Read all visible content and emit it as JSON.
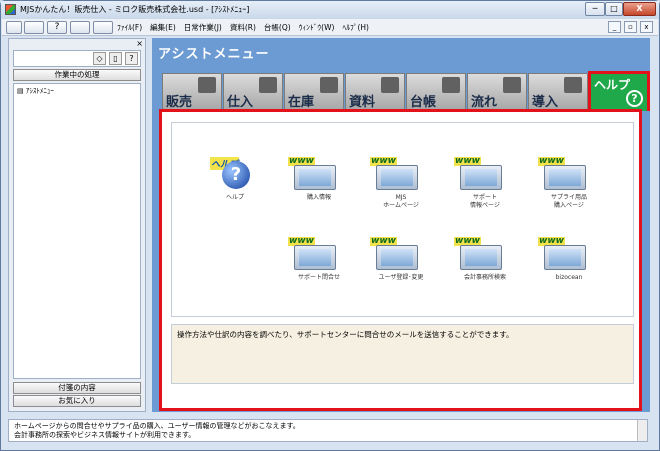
{
  "window": {
    "title": "MJSかんたん！販売仕入 - ミロク販売株式会社.usd - [ｱｼｽﾄﾒﾆｭｰ]",
    "minimize": "─",
    "maximize": "□",
    "close": "X"
  },
  "menu": [
    "ﾌｧｲﾙ(F)",
    "編集(E)",
    "日常作業(J)",
    "資料(R)",
    "台帳(Q)",
    "ｳｨﾝﾄﾞｳ(W)",
    "ﾍﾙﾌﾟ(H)"
  ],
  "mdi": {
    "min": "_",
    "restore": "▫",
    "close": "x"
  },
  "left": {
    "close": "×",
    "processing_header": "作業中の処理",
    "tree_item": "ｱｼｽﾄﾒﾆｭｰ",
    "notes": "付箋の内容",
    "favorites": "お気に入り"
  },
  "main": {
    "title": "アシストメニュー",
    "tabs": [
      "販売",
      "仕入",
      "在庫",
      "資料",
      "台帳",
      "流れ",
      "導入"
    ],
    "help_tab": "ヘルプ",
    "help_tab_icon": "?"
  },
  "icons": [
    {
      "name": "help",
      "label": "ヘルプ",
      "badge": "ヘルプ",
      "symbol": "?"
    },
    {
      "name": "purchase-info",
      "label": "購入情報",
      "badge": "www"
    },
    {
      "name": "mjs-homepage",
      "label": "MJS\nホームページ",
      "badge": "www"
    },
    {
      "name": "support-info",
      "label": "サポート\n情報ページ",
      "badge": "www"
    },
    {
      "name": "supply-purchase",
      "label": "サプライ用品\n購入ページ",
      "badge": "www"
    },
    {
      "name": "support-contact",
      "label": "サポート問合せ",
      "badge": "www"
    },
    {
      "name": "user-registration",
      "label": "ユーザ登録･変更",
      "badge": "www"
    },
    {
      "name": "accountant-search",
      "label": "会計事務所検索",
      "badge": "www"
    },
    {
      "name": "bizocean",
      "label": "bizocean",
      "badge": "www"
    }
  ],
  "description": "操作方法や仕訳の内容を調べたり、サポートセンターに問合せのメールを送信することができます。",
  "status": {
    "line1": "ホームページからの問合せやサプライ品の購入、ユーザー情報の管理などがおこなえます。",
    "line2": "会計事務所の探索やビジネス情報サイトが利用できます。"
  },
  "colors": {
    "help_tab": "#20a94a",
    "highlight": "#e3121a",
    "panel": "#6c9ad3"
  }
}
